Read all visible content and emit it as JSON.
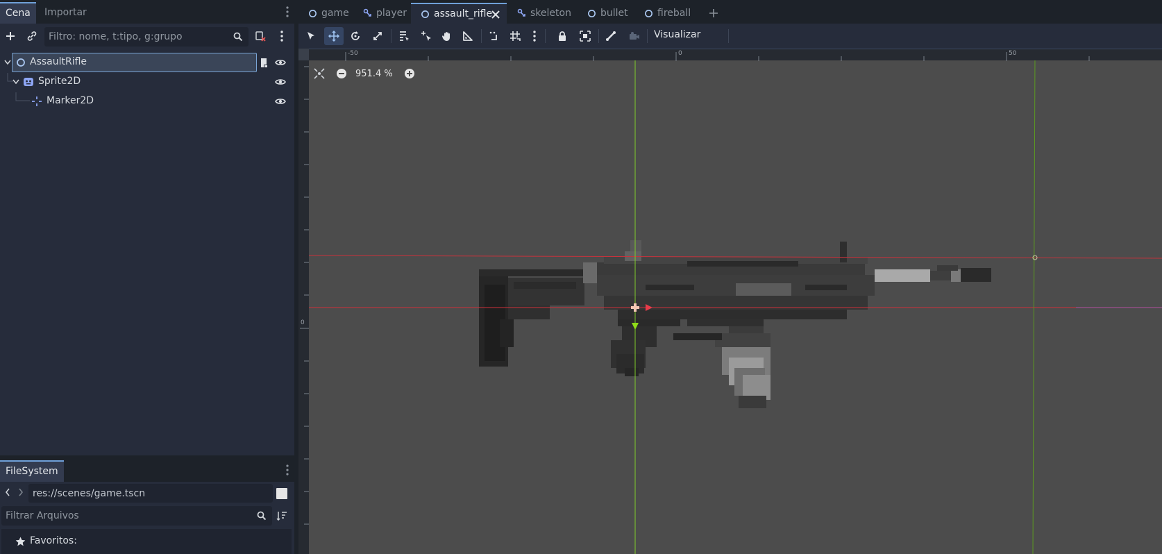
{
  "left_dock": {
    "tabs": [
      "Cena",
      "Importar"
    ],
    "filter_placeholder": "Filtro: nome, t:tipo, g:grupo",
    "tree": [
      {
        "label": "AssaultRifle",
        "icon": "node-circle-icon"
      },
      {
        "label": "Sprite2D",
        "icon": "sprite2d-icon"
      },
      {
        "label": "Marker2D",
        "icon": "marker2d-icon"
      }
    ]
  },
  "filesystem": {
    "tab": "FileSystem",
    "path": "res://scenes/game.tscn",
    "filter_placeholder": "Filtrar Arquivos",
    "favorites_label": "Favoritos:"
  },
  "scene_tabs": [
    {
      "label": "game",
      "icon": "node-circle-icon"
    },
    {
      "label": "player",
      "icon": "skeleton-node-icon"
    },
    {
      "label": "assault_rifle",
      "icon": "node-circle-icon",
      "active": true
    },
    {
      "label": "skeleton",
      "icon": "skeleton-node-icon"
    },
    {
      "label": "bullet",
      "icon": "node-circle-icon"
    },
    {
      "label": "fireball",
      "icon": "node-circle-icon"
    }
  ],
  "toolbar": {
    "view_menu": "Visualizar"
  },
  "viewport": {
    "zoom": "951.4 %",
    "ruler_labels": [
      "-50",
      "0",
      "50"
    ],
    "left_ruler_label": "0"
  },
  "colors": {
    "accent": "#6fa0d8",
    "axis_x": "#d0303a",
    "axis_y": "#7fcc2a",
    "viewport_bg": "#4c4c4c"
  }
}
